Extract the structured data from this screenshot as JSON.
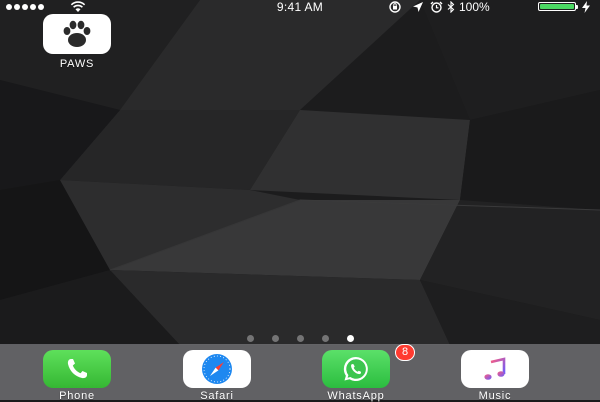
{
  "status_bar": {
    "time": "9:41 AM",
    "battery_percent": "100%",
    "battery_level": 1.0,
    "signal_bars": 5,
    "icons": [
      "wifi-icon",
      "orientation-lock-icon",
      "location-icon",
      "alarm-icon",
      "bluetooth-icon",
      "battery-icon",
      "charging-bolt-icon"
    ]
  },
  "home": {
    "apps": [
      {
        "label": "PAWS",
        "icon": "paw-icon"
      }
    ]
  },
  "page_indicator": {
    "pages": 5,
    "current": 5
  },
  "dock": {
    "apps": [
      {
        "label": "Phone",
        "icon": "phone-icon"
      },
      {
        "label": "Safari",
        "icon": "compass-icon"
      },
      {
        "label": "WhatsApp",
        "icon": "whatsapp-icon",
        "badge": "8"
      },
      {
        "label": "Music",
        "icon": "music-note-icon"
      }
    ]
  },
  "colors": {
    "accent_green": "#4cd964",
    "badge_red": "#ff3b30",
    "music_pink": "#fc3c8d"
  }
}
